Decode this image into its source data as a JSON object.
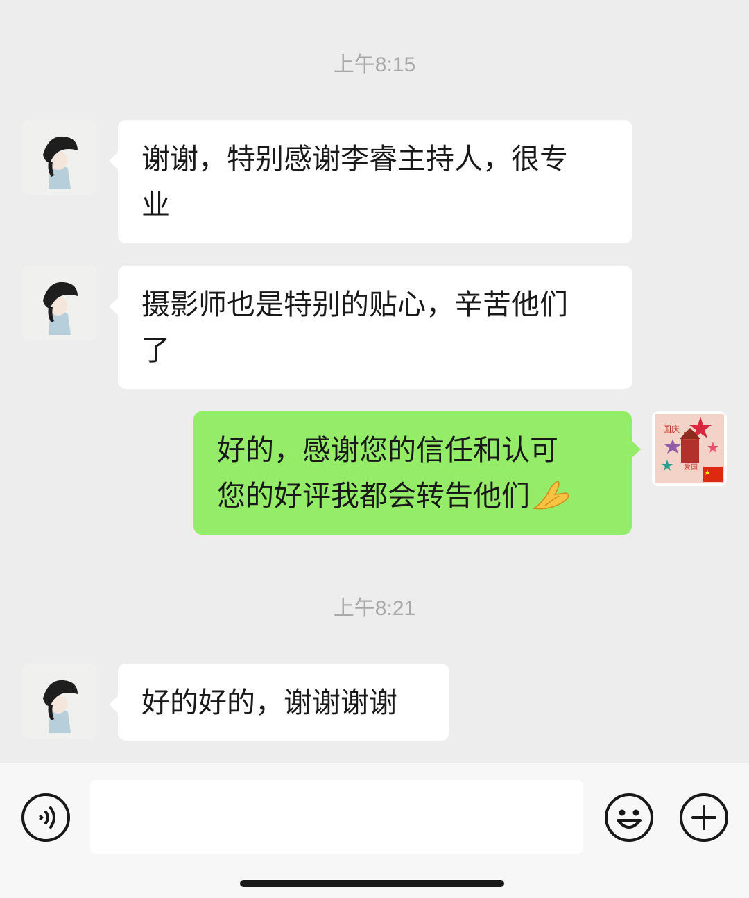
{
  "messages": [
    {
      "type": "time",
      "text": "上午8:15"
    },
    {
      "type": "incoming",
      "lines": [
        "谢谢，特别感谢李睿主持人，很专",
        "业"
      ]
    },
    {
      "type": "incoming",
      "lines": [
        "摄影师也是特别的贴心，辛苦他们",
        "了"
      ]
    },
    {
      "type": "outgoing",
      "lines": [
        "好的，感谢您的信任和认可",
        "您的好评我都会转告他们"
      ],
      "emoji": "folded-hands-emoji"
    },
    {
      "type": "time",
      "text": "上午8:21"
    },
    {
      "type": "incoming",
      "lines": [
        "好的好的，谢谢谢谢"
      ]
    }
  ],
  "self_avatar": {
    "labels": [
      "国庆",
      "爱国"
    ]
  },
  "input_bar": {
    "input_value": "",
    "voice_icon": "voice-icon",
    "emoji_icon": "smiley-icon",
    "plus_icon": "plus-icon"
  },
  "colors": {
    "background": "#ededed",
    "incoming_bubble": "#ffffff",
    "outgoing_bubble": "#95ec69",
    "timestamp": "#a8a8a8"
  }
}
